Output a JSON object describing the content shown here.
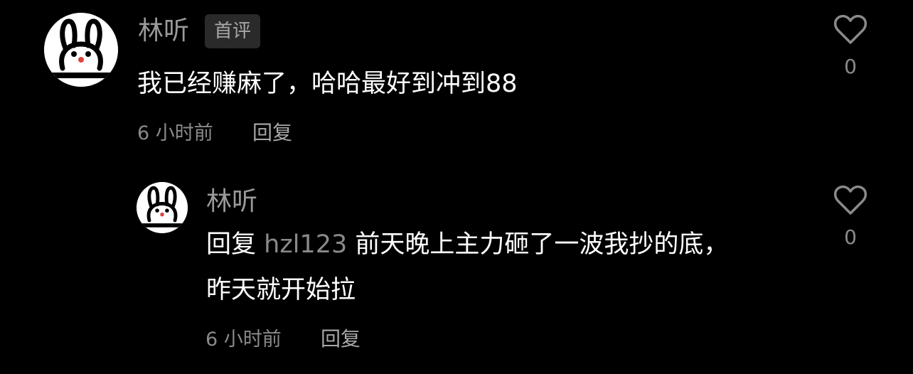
{
  "colors": {
    "background": "#000000",
    "username": "#9a9a9a",
    "badge_bg": "#2a2a2a",
    "meta": "#8a8a8a",
    "text": "#ffffff"
  },
  "comments": [
    {
      "author": "林听",
      "badge": "首评",
      "text": "我已经赚麻了，哈哈最好到冲到88",
      "time": "6 小时前",
      "reply_label": "回复",
      "like_icon": "heart-outline-icon",
      "likes": "0",
      "avatar_icon": "bunny-avatar-icon"
    }
  ],
  "replies": [
    {
      "author": "林听",
      "reply_prefix": "回复",
      "reply_to": "hzl123",
      "text_line1": "前天晚上主力砸了一波我抄的底，",
      "text_line2": "昨天就开始拉",
      "time": "6 小时前",
      "reply_label": "回复",
      "like_icon": "heart-outline-icon",
      "likes": "0",
      "avatar_icon": "bunny-avatar-icon"
    }
  ]
}
